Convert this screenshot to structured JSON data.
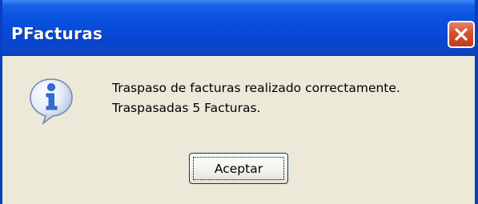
{
  "window": {
    "title": "PFacturas"
  },
  "dialog": {
    "icon": "info-icon",
    "message_line1": "Traspaso de facturas realizado correctamente.",
    "message_line2": "Traspasadas 5 Facturas.",
    "ok_label": "Aceptar"
  },
  "colors": {
    "titlebar": "#0a52e0",
    "window_border": "#0a3fbf",
    "dialog_bg": "#ece9d8",
    "close_button": "#d6502d",
    "info_icon": "#2f6fd8"
  }
}
